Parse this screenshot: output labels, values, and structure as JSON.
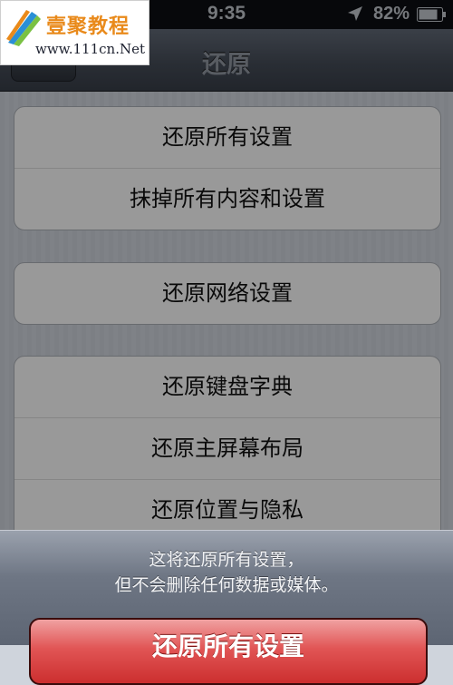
{
  "status_bar": {
    "time": "9:35",
    "battery_percent": "82%",
    "icons": [
      "location-arrow-icon",
      "battery-icon"
    ]
  },
  "nav": {
    "title": "还原"
  },
  "watermark": {
    "name": "壹聚教程",
    "url": "www.111cn.Net"
  },
  "groups": [
    {
      "items": [
        "还原所有设置",
        "抹掉所有内容和设置"
      ]
    },
    {
      "items": [
        "还原网络设置"
      ]
    },
    {
      "items": [
        "还原键盘字典",
        "还原主屏幕布局",
        "还原位置与隐私"
      ]
    }
  ],
  "action_sheet": {
    "message_line1": "这将还原所有设置，",
    "message_line2": "但不会删除任何数据或媒体。",
    "confirm_label": "还原所有设置"
  },
  "colors": {
    "nav_bar": "#444b56",
    "confirm_button": "#e15555",
    "status_bar": "#0c0e12"
  }
}
